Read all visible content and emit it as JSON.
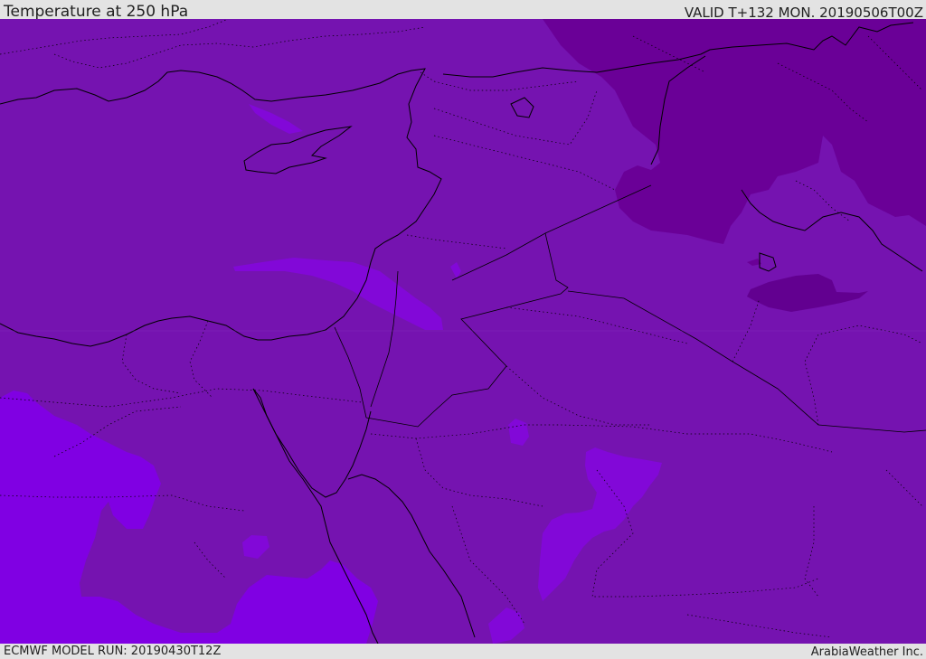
{
  "header": {
    "title": "Temperature at 250 hPa",
    "valid": "VALID T+132 MON. 20190506T00Z"
  },
  "footer": {
    "model_run": "ECMWF MODEL RUN: 20190430T12Z",
    "credit": "ArabiaWeather Inc."
  },
  "map": {
    "colors": {
      "base_field": "#7513b0",
      "cold_field": "#6a0097",
      "warm_field": "#8000e3",
      "warm_patch": "#8208d8",
      "cold_patch": "#620090",
      "coastline": "#000000"
    }
  }
}
